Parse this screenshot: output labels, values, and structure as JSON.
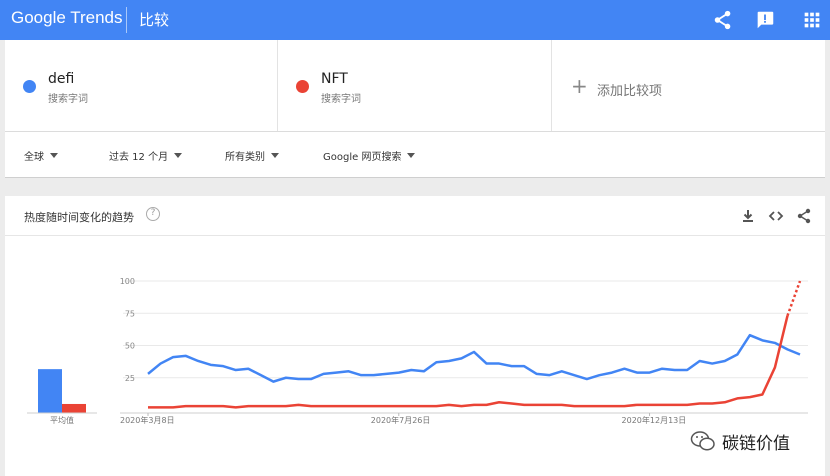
{
  "header": {
    "logo_text": "Google Trends",
    "page_title": "比较",
    "icons": [
      "share-icon",
      "feedback-icon",
      "apps-grid-icon"
    ]
  },
  "terms": [
    {
      "name": "defi",
      "subtitle": "搜索字词",
      "color": "#4285f4"
    },
    {
      "name": "NFT",
      "subtitle": "搜索字词",
      "color": "#ea4335"
    }
  ],
  "add_term_label": "添加比较项",
  "filters": [
    {
      "label": "全球"
    },
    {
      "label": "过去 12 个月"
    },
    {
      "label": "所有类别"
    },
    {
      "label": "Google 网页搜索"
    }
  ],
  "card": {
    "title": "热度随时间变化的趋势",
    "icons": [
      "download-icon",
      "embed-icon",
      "share-icon"
    ]
  },
  "chart_data": {
    "type": "line",
    "y_ticks": [
      25,
      50,
      75,
      100
    ],
    "ylim": [
      0,
      100
    ],
    "x_tick_labels": [
      {
        "label": "2020年3月8日",
        "index": 0
      },
      {
        "label": "2020年7月26日",
        "index": 20
      },
      {
        "label": "2020年12月13日",
        "index": 40
      }
    ],
    "grid": true,
    "series": [
      {
        "name": "defi",
        "color": "#4285f4",
        "values": [
          28,
          36,
          41,
          42,
          38,
          35,
          34,
          31,
          32,
          27,
          22,
          25,
          24,
          24,
          28,
          29,
          30,
          27,
          27,
          28,
          29,
          31,
          30,
          37,
          38,
          40,
          45,
          36,
          36,
          34,
          34,
          28,
          27,
          30,
          27,
          24,
          27,
          29,
          32,
          29,
          29,
          32,
          31,
          31,
          38,
          36,
          38,
          43,
          58,
          54,
          52,
          47,
          43
        ]
      },
      {
        "name": "NFT",
        "color": "#ea4335",
        "partial_from_index": 51,
        "values": [
          2,
          2,
          2,
          3,
          3,
          3,
          3,
          2,
          3,
          3,
          3,
          3,
          4,
          3,
          3,
          3,
          3,
          3,
          3,
          3,
          3,
          3,
          3,
          3,
          4,
          3,
          4,
          4,
          6,
          5,
          4,
          4,
          4,
          4,
          3,
          3,
          3,
          3,
          3,
          4,
          4,
          4,
          4,
          4,
          5,
          5,
          6,
          9,
          10,
          12,
          33,
          73,
          100
        ]
      }
    ],
    "avg_bar": {
      "label": "平均值",
      "values": [
        {
          "series": "defi",
          "value": 34,
          "color": "#4285f4"
        },
        {
          "series": "NFT",
          "value": 7,
          "color": "#ea4335"
        }
      ]
    }
  },
  "watermark": {
    "text": "碳链价值"
  }
}
